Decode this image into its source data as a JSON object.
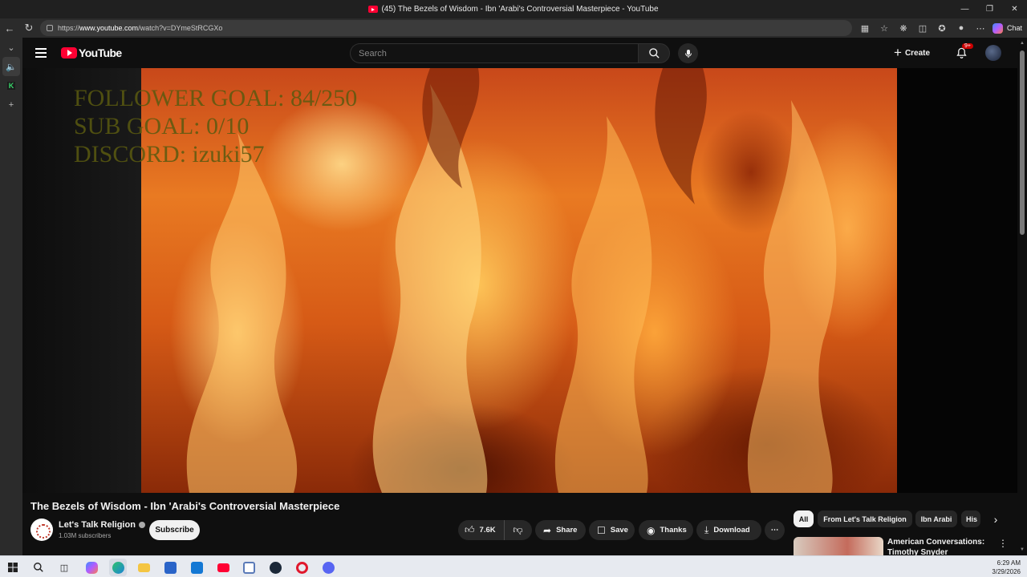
{
  "browser": {
    "window_title": "(45) The Bezels of Wisdom - Ibn 'Arabi's Controversial Masterpiece - YouTube",
    "url_prefix": "https://",
    "url_host": "www.youtube.com",
    "url_path": "/watch?v=DYmeStRCGXo",
    "chat_label": "Chat"
  },
  "youtube": {
    "logo_text": "YouTube",
    "search_placeholder": "Search",
    "create_label": "Create",
    "notification_badge": "9+"
  },
  "video": {
    "overlay_lines": [
      "FOLLOWER GOAL:  84/250",
      "SUB GOAL: 0/10",
      "DISCORD: izuki57"
    ],
    "title": "The Bezels of Wisdom - Ibn 'Arabi's Controversial Masterpiece",
    "channel_name": "Let's Talk Religion",
    "subscribers": "1.03M subscribers",
    "subscribe_label": "Subscribe",
    "like_count": "7.6K",
    "share_label": "Share",
    "save_label": "Save",
    "thanks_label": "Thanks",
    "download_label": "Download"
  },
  "related": {
    "chips": [
      "All",
      "From Let's Talk Religion",
      "Ibn Arabi",
      "His"
    ],
    "first_video_title": "American Conversations: Timothy Snyder"
  },
  "taskbar": {
    "time": "6:29 AM",
    "date": "3/29/2026"
  },
  "colors": {
    "youtube_red": "#ff0033",
    "page_bg": "#0f0f0f",
    "button_bg": "#272727",
    "overlay_text": "#5a5a10"
  },
  "icons": [
    "back-icon",
    "refresh-icon",
    "search-icon",
    "mic-icon",
    "bell-icon",
    "like-icon",
    "dislike-icon",
    "share-icon",
    "save-icon",
    "thanks-icon",
    "download-icon",
    "more-icon"
  ]
}
